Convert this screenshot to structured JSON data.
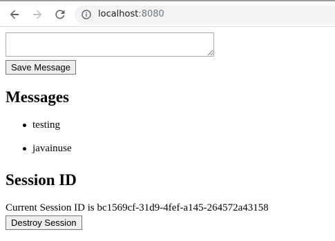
{
  "browser": {
    "back_icon": "arrow-left-icon",
    "forward_icon": "arrow-right-icon",
    "reload_icon": "reload-icon",
    "info_icon": "info-circle-icon",
    "url_host": "localhost",
    "url_port": ":8080"
  },
  "form": {
    "message_value": "",
    "save_label": "Save Message"
  },
  "messages": {
    "heading": "Messages",
    "items": [
      "testing",
      "javainuse"
    ]
  },
  "session": {
    "heading": "Session ID",
    "id_line": "Current Session ID is bc1569cf-31d9-4fef-a145-264572a43158",
    "destroy_label": "Destroy Session"
  }
}
